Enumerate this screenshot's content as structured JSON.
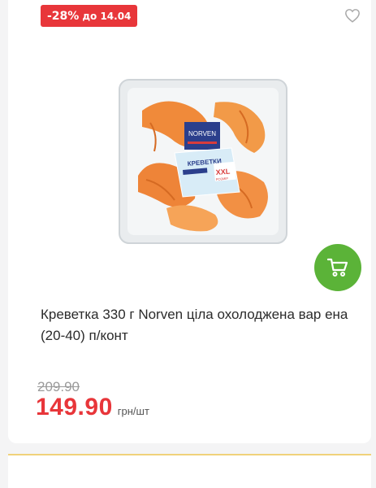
{
  "promo": {
    "discount": "-28%",
    "until": "до 14.04"
  },
  "product": {
    "title": "Креветка 330 г Norven ціла охолоджена вар ена (20-40) п/конт",
    "image": {
      "brand": "NORVEN",
      "label": "КРЕВЕТКИ",
      "size_badge": "XXL",
      "size_sub": "РОЗМІР"
    },
    "old_price": "209.90",
    "price": "149.90",
    "unit": "грн/шт"
  },
  "colors": {
    "accent_red": "#e8363a",
    "cart_green": "#5bb338"
  },
  "icons": {
    "favorite": "heart-outline-icon",
    "cart": "shopping-cart-icon"
  }
}
